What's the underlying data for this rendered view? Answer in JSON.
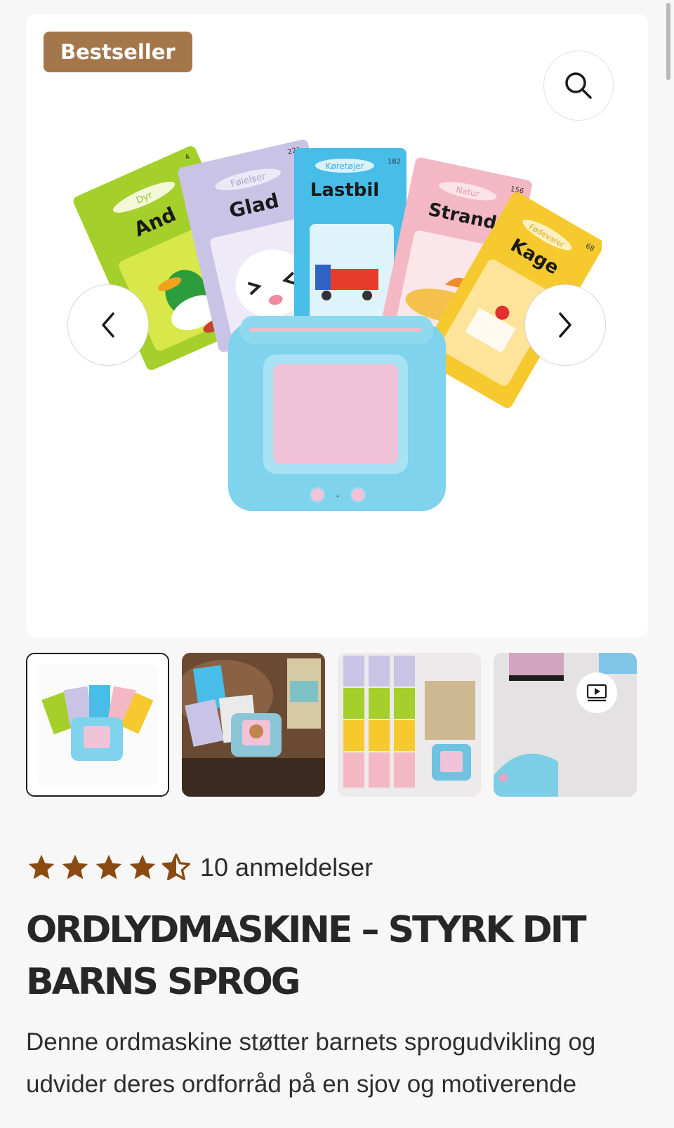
{
  "badge": "Bestseller",
  "gallery": {
    "card_words": [
      {
        "category": "Dyr",
        "word": "And",
        "number": "4",
        "color": "#a5cf2a"
      },
      {
        "category": "Følelser",
        "word": "Glad",
        "number": "221",
        "color": "#c9c4e6"
      },
      {
        "category": "Køretøjer",
        "word": "Lastbil",
        "number": "182",
        "color": "#48bde8"
      },
      {
        "category": "Natur",
        "word": "Strand",
        "number": "156",
        "color": "#f3b8c4"
      },
      {
        "category": "Fødevarer",
        "word": "Kage",
        "number": "68",
        "color": "#f6c92e"
      }
    ],
    "device_color": "#7fd3ec",
    "screen_color": "#f0c3d9",
    "thumbnail_count": 4,
    "video_icon": "play-video-icon"
  },
  "rating": {
    "value": 4.5,
    "max": 5,
    "star_color": "#8a4a12",
    "label": "10 anmeldelser"
  },
  "product": {
    "title": "ORDLYDMASKINE – STYRK DIT BARNS SPROG",
    "description": "Denne ordmaskine støtter barnets sprogudvikling og udvider deres ordforråd på en sjov og motiverende"
  },
  "icons": {
    "zoom": "search-icon",
    "prev": "chevron-left-icon",
    "next": "chevron-right-icon"
  },
  "colors": {
    "badge_bg": "#a4774a",
    "page_bg": "#f7f7f7",
    "title_color": "#272727"
  }
}
